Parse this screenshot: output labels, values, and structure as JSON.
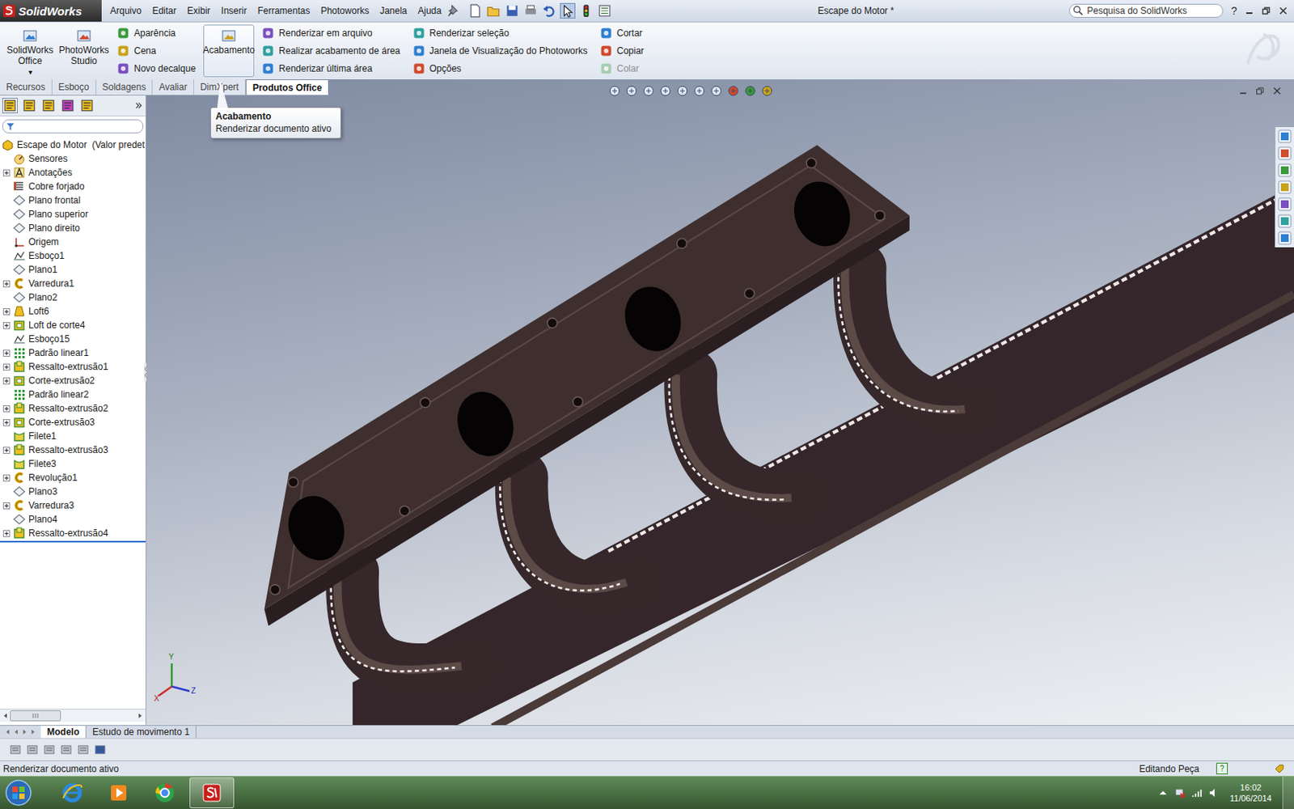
{
  "app": {
    "name": "SolidWorks"
  },
  "menu": [
    "Arquivo",
    "Editar",
    "Exibir",
    "Inserir",
    "Ferramentas",
    "Photoworks",
    "Janela",
    "Ajuda"
  ],
  "window": {
    "title": "Escape do Motor *"
  },
  "search": {
    "placeholder": "Pesquisa do SolidWorks"
  },
  "help": "?",
  "ribbon": [
    {
      "kind": "large",
      "label": "SolidWorks Office",
      "arrow": "▾",
      "selected": false
    },
    {
      "kind": "large",
      "label": "PhotoWorks Studio",
      "arrow": "",
      "selected": false
    },
    {
      "kind": "column",
      "items": [
        {
          "label": "Aparência",
          "disabled": false
        },
        {
          "label": "Cena",
          "disabled": false
        },
        {
          "label": "Novo decalque",
          "disabled": false
        }
      ]
    },
    {
      "kind": "large",
      "label": "Acabamento",
      "arrow": "",
      "selected": true
    },
    {
      "kind": "column",
      "items": [
        {
          "label": "Renderizar em arquivo",
          "disabled": false
        },
        {
          "label": "Realizar acabamento de área",
          "disabled": false
        },
        {
          "label": "Renderizar última área",
          "disabled": false
        }
      ]
    },
    {
      "kind": "column",
      "items": [
        {
          "label": "Renderizar seleção",
          "disabled": false
        },
        {
          "label": "Janela de Visualização do Photoworks",
          "disabled": false
        },
        {
          "label": "Opções",
          "disabled": false
        }
      ]
    },
    {
      "kind": "column",
      "items": [
        {
          "label": "Cortar",
          "disabled": false
        },
        {
          "label": "Copiar",
          "disabled": false
        },
        {
          "label": "Colar",
          "disabled": true
        }
      ]
    }
  ],
  "tabs": [
    {
      "label": "Recursos",
      "selected": false
    },
    {
      "label": "Esboço",
      "selected": false
    },
    {
      "label": "Soldagens",
      "selected": false
    },
    {
      "label": "Avaliar",
      "selected": false
    },
    {
      "label": "DimXpert",
      "selected": false
    },
    {
      "label": "Produtos Office",
      "selected": true
    }
  ],
  "tooltip": {
    "title": "Acabamento",
    "text": "Renderizar documento ativo"
  },
  "feature_tree": {
    "root": "Escape do Motor  (Valor predet",
    "items": [
      {
        "label": "Sensores",
        "kind": "sensor",
        "expandable": false
      },
      {
        "label": "Anotações",
        "kind": "annotation",
        "expandable": true
      },
      {
        "label": "Cobre forjado",
        "kind": "material",
        "expandable": false
      },
      {
        "label": "Plano frontal",
        "kind": "plane",
        "expandable": false
      },
      {
        "label": "Plano superior",
        "kind": "plane",
        "expandable": false
      },
      {
        "label": "Plano direito",
        "kind": "plane",
        "expandable": false
      },
      {
        "label": "Origem",
        "kind": "origin",
        "expandable": false
      },
      {
        "label": "Esboço1",
        "kind": "sketch",
        "expandable": false
      },
      {
        "label": "Plano1",
        "kind": "plane",
        "expandable": false
      },
      {
        "label": "Varredura1",
        "kind": "sweep",
        "expandable": true
      },
      {
        "label": "Plano2",
        "kind": "plane",
        "expandable": false
      },
      {
        "label": "Loft6",
        "kind": "loft",
        "expandable": true
      },
      {
        "label": "Loft de corte4",
        "kind": "cut-loft",
        "expandable": true
      },
      {
        "label": "Esboço15",
        "kind": "sketch",
        "expandable": false
      },
      {
        "label": "Padrão linear1",
        "kind": "pattern",
        "expandable": true
      },
      {
        "label": "Ressalto-extrusão1",
        "kind": "boss",
        "expandable": true
      },
      {
        "label": "Corte-extrusão2",
        "kind": "cut",
        "expandable": true
      },
      {
        "label": "Padrão linear2",
        "kind": "pattern",
        "expandable": false
      },
      {
        "label": "Ressalto-extrusão2",
        "kind": "boss",
        "expandable": true
      },
      {
        "label": "Corte-extrusão3",
        "kind": "cut",
        "expandable": true
      },
      {
        "label": "Filete1",
        "kind": "fillet",
        "expandable": false
      },
      {
        "label": "Ressalto-extrusão3",
        "kind": "boss",
        "expandable": true
      },
      {
        "label": "Filete3",
        "kind": "fillet",
        "expandable": false
      },
      {
        "label": "Revolução1",
        "kind": "revolve",
        "expandable": true
      },
      {
        "label": "Plano3",
        "kind": "plane",
        "expandable": false
      },
      {
        "label": "Varredura3",
        "kind": "sweep",
        "expandable": true
      },
      {
        "label": "Plano4",
        "kind": "plane",
        "expandable": false
      },
      {
        "label": "Ressalto-extrusão4",
        "kind": "boss",
        "expandable": true
      }
    ]
  },
  "axes": [
    "X",
    "Y",
    "Z"
  ],
  "bottom_tabs": [
    {
      "label": "Modelo",
      "selected": true
    },
    {
      "label": "Estudo de movimento 1",
      "selected": false
    }
  ],
  "status_bar": {
    "message": "Renderizar documento ativo",
    "mode": "Editando Peça",
    "help": "?"
  },
  "taskbar": {
    "apps": [
      {
        "kind": "ie",
        "selected": false
      },
      {
        "kind": "media",
        "selected": false
      },
      {
        "kind": "chrome",
        "selected": false
      },
      {
        "kind": "solidworks",
        "selected": true
      }
    ],
    "time": "16:02",
    "date": "11/06/2014"
  }
}
